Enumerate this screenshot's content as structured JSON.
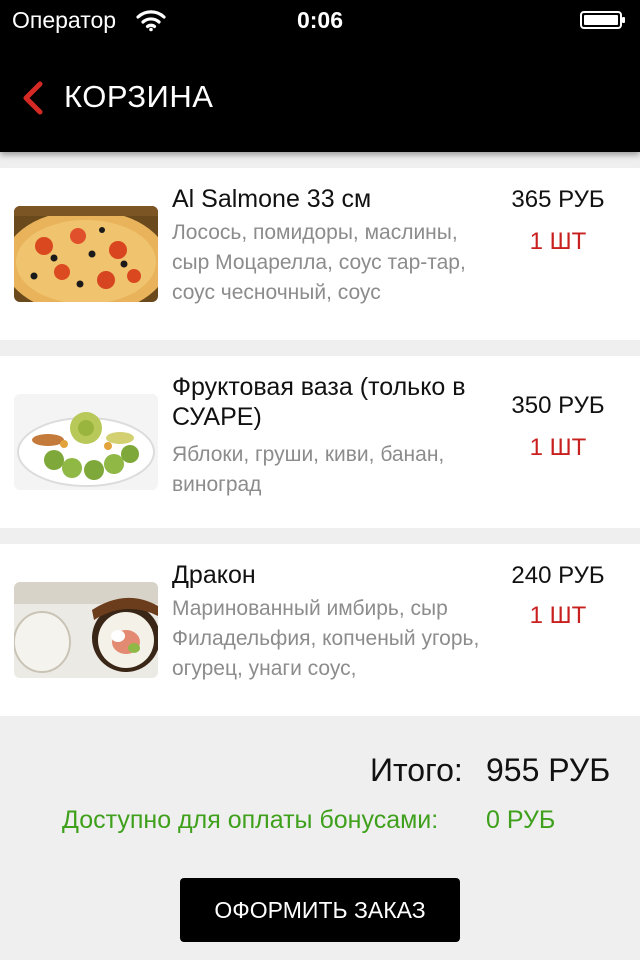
{
  "status_bar": {
    "carrier": "Оператор",
    "time": "0:06"
  },
  "nav": {
    "title": "КОРЗИНА",
    "back_icon": "chevron-left-icon"
  },
  "items": [
    {
      "name": "Al Salmone 33 см",
      "description": "Лосось, помидоры, маслины, сыр Моцарелла, соус тар-тар, соус чесночный, соус",
      "price": "365 РУБ",
      "quantity": "1 ШТ",
      "image": "pizza-photo"
    },
    {
      "name": "Фруктовая ваза (только в СУАРЕ)",
      "description": "Яблоки, груши, киви, банан, виноград",
      "price": "350 РУБ",
      "quantity": "1 ШТ",
      "image": "fruit-plate-photo"
    },
    {
      "name": "Дракон",
      "description": "Маринованный имбирь, сыр Филадельфия, копченый угорь, огурец, унаги соус,",
      "price": "240 РУБ",
      "quantity": "1 ШТ",
      "image": "sushi-roll-photo"
    }
  ],
  "summary": {
    "total_label": "Итого:",
    "total_value": "955 РУБ",
    "bonus_label": "Доступно для оплаты бонусами:",
    "bonus_value": "0 РУБ"
  },
  "checkout_label": "ОФОРМИТЬ ЗАКАЗ",
  "colors": {
    "accent_red": "#c8201e",
    "bonus_green": "#3fa01c",
    "bar_black": "#000000",
    "background": "#efefef"
  }
}
